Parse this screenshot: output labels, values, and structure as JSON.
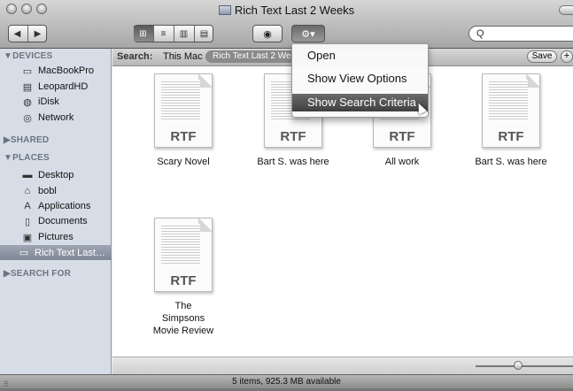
{
  "window": {
    "title": "Rich Text Last 2 Weeks"
  },
  "toolbar": {
    "back_label": "◀",
    "forward_label": "▶",
    "view_icons": [
      "icon-view-icon",
      "list-view-icon",
      "column-view-icon",
      "coverflow-view-icon"
    ],
    "view_glyphs": [
      "⊞",
      "≡",
      "▥",
      "▤"
    ],
    "quicklook_glyph": "◉",
    "action_glyph": "⚙▾",
    "search_placeholder": "Q"
  },
  "sidebar": {
    "devices_header": "▼DEVICES",
    "devices": [
      {
        "label": "MacBookPro",
        "icon": "laptop-icon",
        "glyph": "▭"
      },
      {
        "label": "LeopardHD",
        "icon": "harddisk-icon",
        "glyph": "▤"
      },
      {
        "label": "iDisk",
        "icon": "idisk-icon",
        "glyph": "◍"
      },
      {
        "label": "Network",
        "icon": "network-icon",
        "glyph": "◎"
      }
    ],
    "shared_header": "▶SHARED",
    "places_header": "▼PLACES",
    "places": [
      {
        "label": "Desktop",
        "icon": "desktop-icon",
        "glyph": "▬"
      },
      {
        "label": "bobl",
        "icon": "home-icon",
        "glyph": "⌂"
      },
      {
        "label": "Applications",
        "icon": "applications-icon",
        "glyph": "A"
      },
      {
        "label": "Documents",
        "icon": "documents-icon",
        "glyph": "▯"
      },
      {
        "label": "Pictures",
        "icon": "pictures-icon",
        "glyph": "▣"
      },
      {
        "label": "Rich Text Last…",
        "icon": "smart-folder-icon",
        "glyph": "▭",
        "selected": true
      }
    ],
    "search_for_header": "▶SEARCH FOR"
  },
  "searchbar": {
    "search_label": "Search:",
    "this_mac": "This Mac",
    "chip_label": "Rich Text Last 2 Weeks",
    "save_label": "Save",
    "plus_label": "+"
  },
  "action_menu": {
    "items": [
      {
        "label": "Open"
      },
      {
        "label": "Show View Options"
      },
      {
        "label": "Show Search Criteria",
        "highlighted": true
      }
    ]
  },
  "files": [
    {
      "name": "Scary Novel",
      "type_label": "RTF"
    },
    {
      "name": "Bart S. was here",
      "type_label": "RTF"
    },
    {
      "name": "All work",
      "type_label": "RTF"
    },
    {
      "name": "Bart S. was here",
      "type_label": "RTF"
    },
    {
      "name": "The Simpsons Movie Review",
      "type_label": "RTF"
    }
  ],
  "status": {
    "text": "5 items, 925.3 MB available"
  }
}
